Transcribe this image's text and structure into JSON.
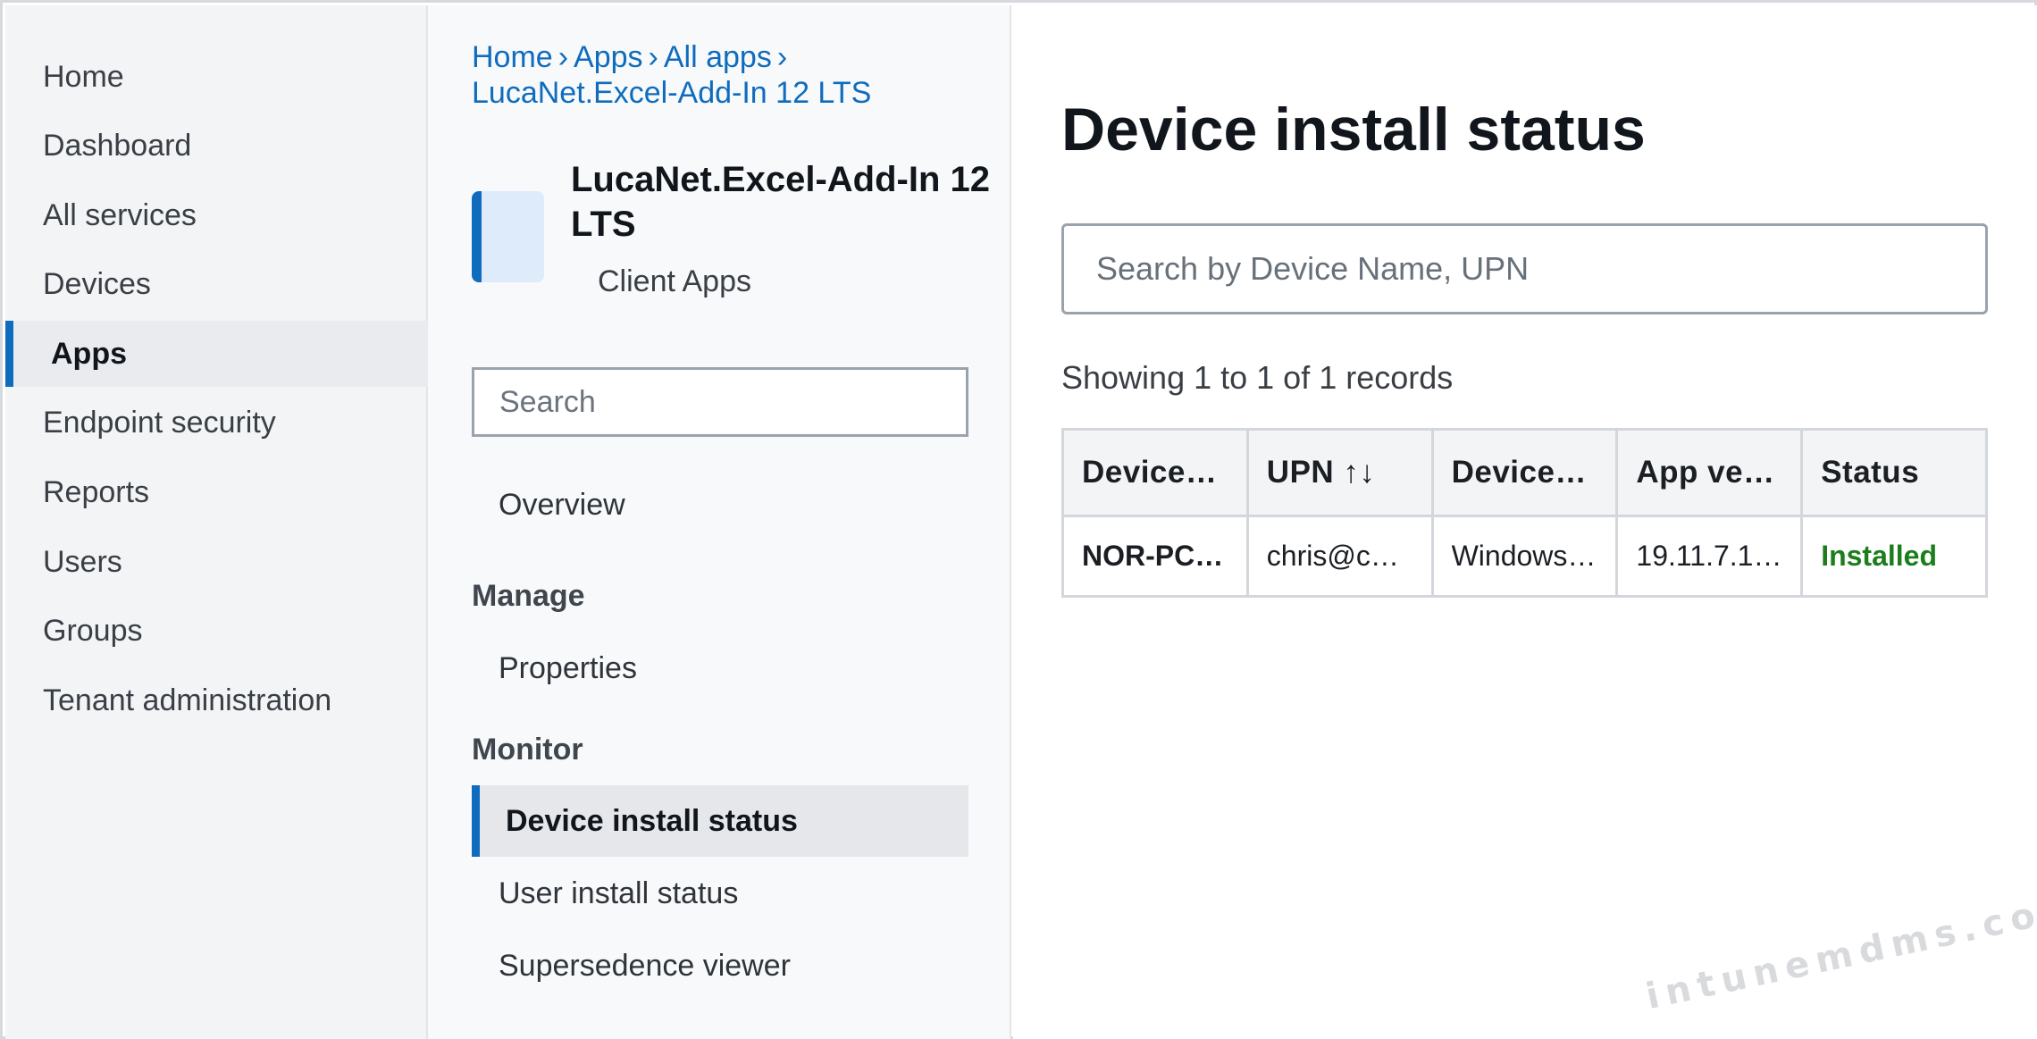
{
  "sidebar": {
    "items": [
      {
        "label": "Home"
      },
      {
        "label": "Dashboard"
      },
      {
        "label": "All services"
      },
      {
        "label": "Devices"
      },
      {
        "label": "Apps",
        "active": true
      },
      {
        "label": "Endpoint security"
      },
      {
        "label": "Reports"
      },
      {
        "label": "Users"
      },
      {
        "label": "Groups"
      },
      {
        "label": "Tenant administration"
      }
    ]
  },
  "breadcrumb": {
    "items": [
      "Home",
      "Apps",
      "All apps",
      "LucaNet.Excel-Add-In 12 LTS"
    ],
    "separator": "›"
  },
  "app": {
    "name": "LucaNet.Excel-Add-In 12 LTS",
    "type": "Client Apps"
  },
  "blade": {
    "search_placeholder": "Search",
    "overview_label": "Overview",
    "manage_label": "Manage",
    "properties_label": "Properties",
    "monitor_label": "Monitor",
    "monitor_items": [
      {
        "label": "Device install status",
        "active": true
      },
      {
        "label": "User install status"
      },
      {
        "label": "Supersedence viewer"
      }
    ]
  },
  "main": {
    "title": "Device install status",
    "search_placeholder": "Search by Device Name, UPN",
    "records_text": "Showing 1 to 1 of 1 records",
    "table": {
      "columns": [
        "Device…",
        "UPN ↑↓",
        "Device…",
        "App ve…",
        "Status"
      ],
      "rows": [
        [
          "NOR-PC…",
          "chris@c…",
          "Windows…",
          "19.11.7.1…",
          "Installed"
        ]
      ]
    }
  },
  "watermark": "intunemdms.com",
  "colors": {
    "accent": "#0f6cbd",
    "status_installed": "#1b7d1b"
  }
}
